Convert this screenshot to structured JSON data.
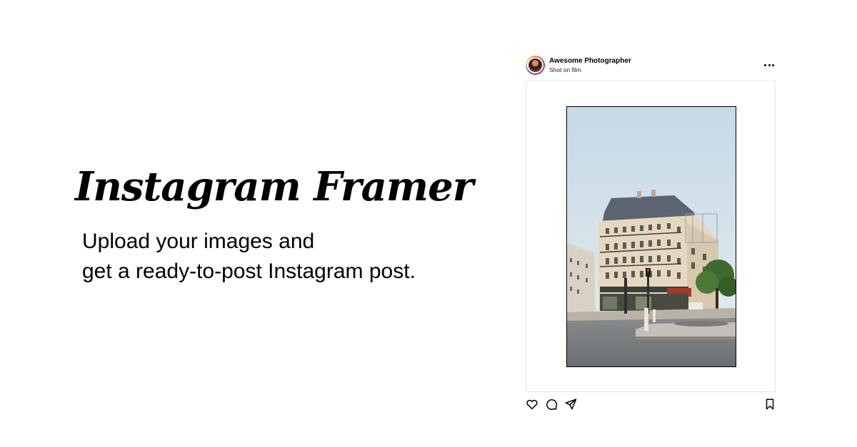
{
  "hero": {
    "title": "Instagram Framer",
    "subtitle_line1": "Upload your images and",
    "subtitle_line2": "get a ready-to-post Instagram post."
  },
  "post": {
    "username": "Awesome Photographer",
    "caption": "Shot on film",
    "photo_alt": "Street photo of a Parisian corner building"
  },
  "icons": {
    "more": "more-horizontal-icon",
    "like": "heart-icon",
    "comment": "comment-icon",
    "share": "send-icon",
    "save": "bookmark-icon"
  },
  "colors": {
    "background": "#ffffff",
    "text": "#000000",
    "frame_border": "#e6e6e6",
    "sky": "#c9dbe7"
  }
}
